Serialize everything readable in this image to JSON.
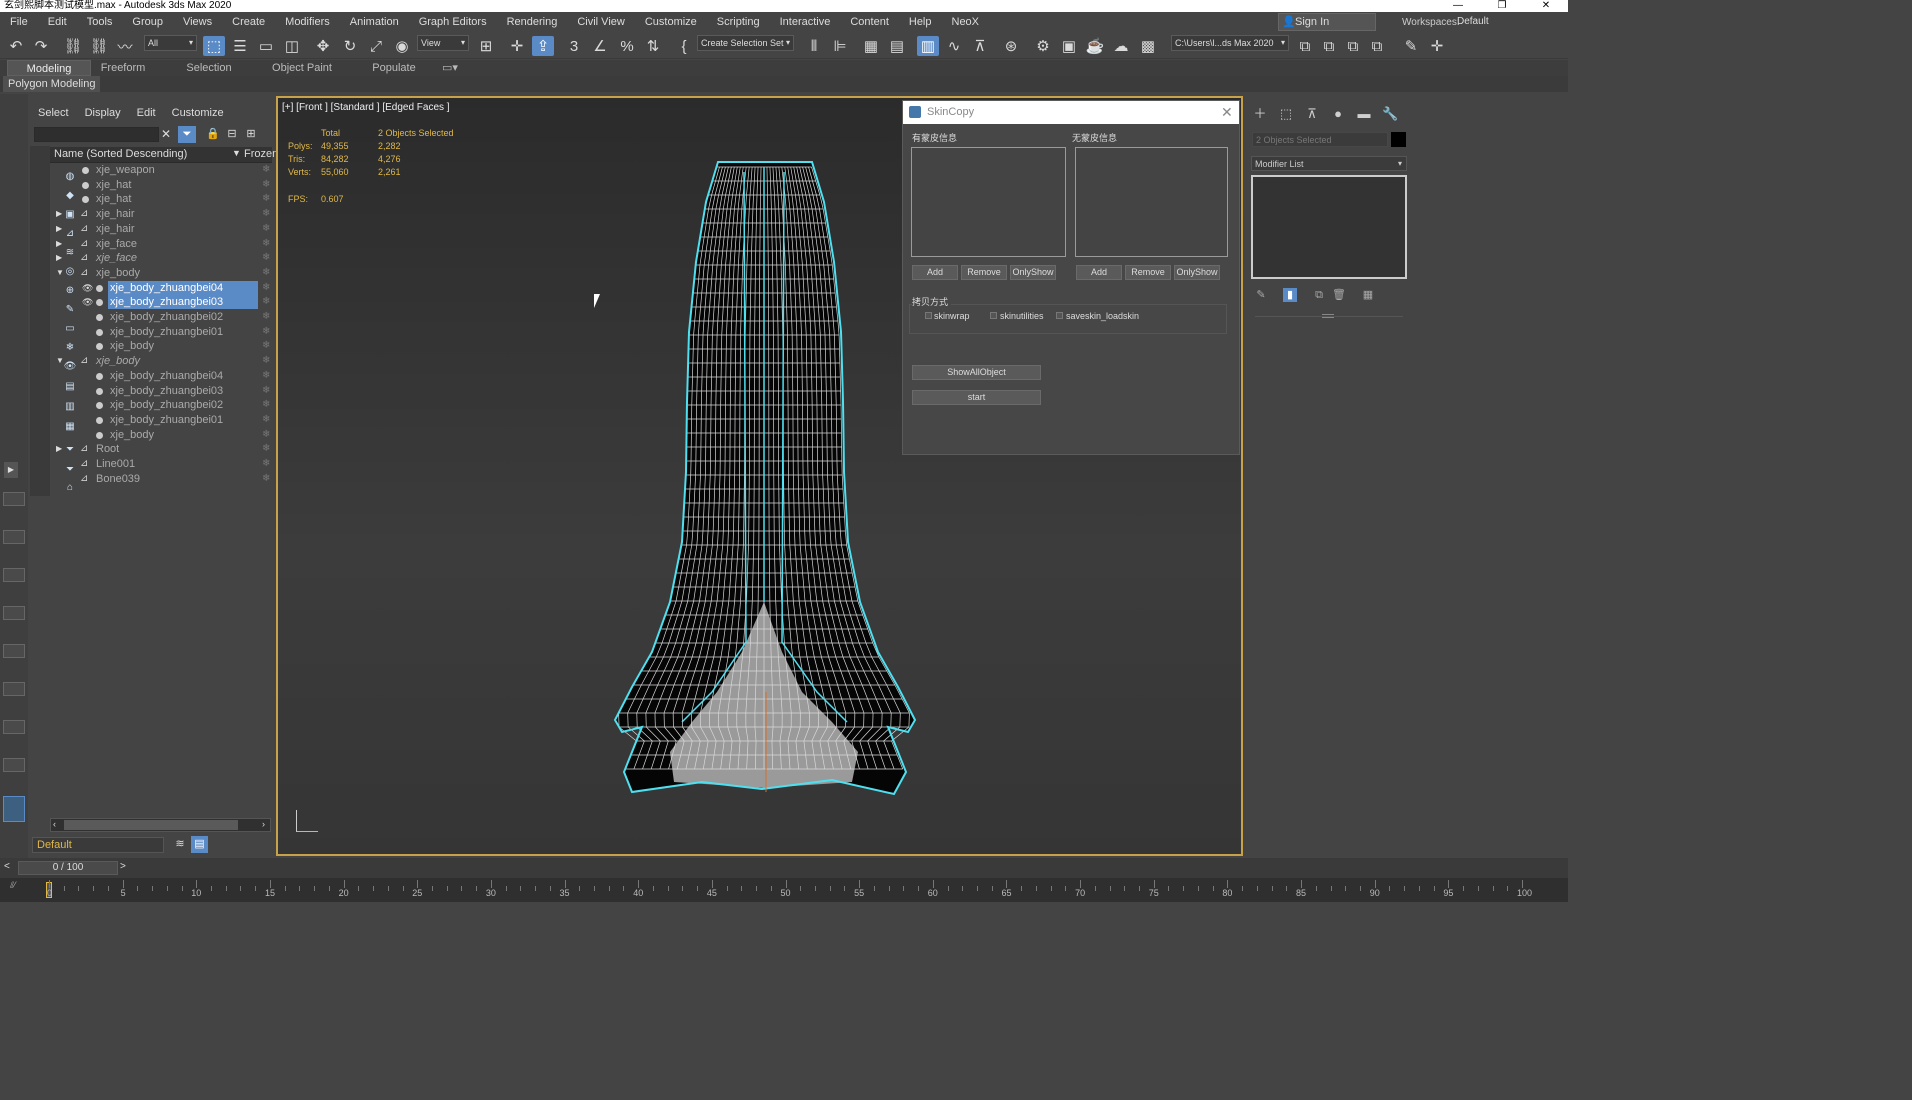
{
  "window": {
    "title": "玄剑熙脚本测试模型.max - Autodesk 3ds Max 2020",
    "controls": [
      "—",
      "❐",
      "✕"
    ]
  },
  "menu": [
    "File",
    "Edit",
    "Tools",
    "Group",
    "Views",
    "Create",
    "Modifiers",
    "Animation",
    "Graph Editors",
    "Rendering",
    "Civil View",
    "Customize",
    "Scripting",
    "Interactive",
    "Content",
    "Help",
    "NeoX"
  ],
  "signin": "Sign In",
  "workspaces": {
    "label": "Workspaces:",
    "value": "Default"
  },
  "toolbar": {
    "filter_value": "All",
    "view_value": "View",
    "selection_set": "Create Selection Set",
    "path": "C:\\Users\\l...ds Max 2020"
  },
  "ribbon_tabs": [
    "Modeling",
    "Freeform",
    "Selection",
    "Object Paint",
    "Populate"
  ],
  "ribbon_active": 0,
  "polygon_modeling": "Polygon Modeling",
  "scene_explorer": {
    "menu": [
      "Select",
      "Display",
      "Edit",
      "Customize"
    ],
    "search_placeholder": "",
    "col_name": "Name (Sorted Descending)",
    "col_frozen": "Frozen",
    "rows": [
      {
        "name": "xje_weapon",
        "level": 0,
        "icon": "dot",
        "dim": true
      },
      {
        "name": "xje_hat",
        "level": 0,
        "icon": "dot",
        "dim": true
      },
      {
        "name": "xje_hat",
        "level": 0,
        "icon": "dot",
        "dim": true
      },
      {
        "name": "xje_hair",
        "level": 0,
        "icon": "bone",
        "exp": "▶",
        "dim": true
      },
      {
        "name": "xje_hair",
        "level": 0,
        "icon": "bone",
        "exp": "▶",
        "dim": true
      },
      {
        "name": "xje_face",
        "level": 0,
        "icon": "bone",
        "exp": "▶",
        "dim": true
      },
      {
        "name": "xje_face",
        "level": 0,
        "icon": "bone",
        "exp": "▶",
        "italic": true
      },
      {
        "name": "xje_body",
        "level": 0,
        "icon": "bone",
        "exp": "▼",
        "dim": true
      },
      {
        "name": "xje_body_zhuangbei04",
        "level": 1,
        "icon": "dot",
        "selected": true,
        "eye": true
      },
      {
        "name": "xje_body_zhuangbei03",
        "level": 1,
        "icon": "dot",
        "selected": true,
        "eye": true
      },
      {
        "name": "xje_body_zhuangbei02",
        "level": 1,
        "icon": "dot",
        "dim": true
      },
      {
        "name": "xje_body_zhuangbei01",
        "level": 1,
        "icon": "dot",
        "dim": true
      },
      {
        "name": "xje_body",
        "level": 1,
        "icon": "dot",
        "dim": true
      },
      {
        "name": "xje_body",
        "level": 0,
        "icon": "bone",
        "exp": "▼",
        "italic": true
      },
      {
        "name": "xje_body_zhuangbei04",
        "level": 1,
        "icon": "dot",
        "dim": true
      },
      {
        "name": "xje_body_zhuangbei03",
        "level": 1,
        "icon": "dot",
        "dim": true
      },
      {
        "name": "xje_body_zhuangbei02",
        "level": 1,
        "icon": "dot",
        "dim": true
      },
      {
        "name": "xje_body_zhuangbei01",
        "level": 1,
        "icon": "dot",
        "dim": true
      },
      {
        "name": "xje_body",
        "level": 1,
        "icon": "dot",
        "dim": true
      },
      {
        "name": "Root",
        "level": 0,
        "icon": "bone",
        "exp": "▶",
        "dim": true
      },
      {
        "name": "Line001",
        "level": 0,
        "icon": "bone",
        "dim": true
      },
      {
        "name": "Bone039",
        "level": 0,
        "icon": "bone",
        "dim": true
      }
    ],
    "layer": "Default"
  },
  "viewport": {
    "label": "[+] [Front ] [Standard ] [Edged Faces ]",
    "stats": {
      "header_total": "Total",
      "header_sel": "2 Objects Selected",
      "rows": [
        {
          "label": "Polys:",
          "total": "49,355",
          "sel": "2,282"
        },
        {
          "label": "Tris:",
          "total": "84,282",
          "sel": "4,276"
        },
        {
          "label": "Verts:",
          "total": "55,060",
          "sel": "2,261"
        }
      ],
      "fps_label": "FPS:",
      "fps": "0.607"
    }
  },
  "skincopy": {
    "title": "SkinCopy",
    "left_label": "有蒙皮信息",
    "right_label": "无蒙皮信息",
    "buttons": {
      "add": "Add",
      "remove": "Remove",
      "onlyshow": "OnlyShow"
    },
    "group_label": "拷贝方式",
    "options": [
      "skinwrap",
      "skinutilities",
      "saveskin_loadskin"
    ],
    "show_all": "ShowAllObject",
    "start": "start"
  },
  "command_panel": {
    "selection": "2 Objects Selected",
    "modifier_list": "Modifier List"
  },
  "timeline": {
    "frame": "0 / 100",
    "ticks": [
      0,
      5,
      10,
      15,
      20,
      25,
      30,
      35,
      40,
      45,
      50,
      55,
      60,
      65,
      70,
      75,
      80,
      85,
      90,
      95,
      100
    ]
  },
  "colors": {
    "accent": "#5b8bc7",
    "selection_wire": "#4fe0f0",
    "viewport_border": "#c8a248",
    "stats": "#e0b848"
  }
}
